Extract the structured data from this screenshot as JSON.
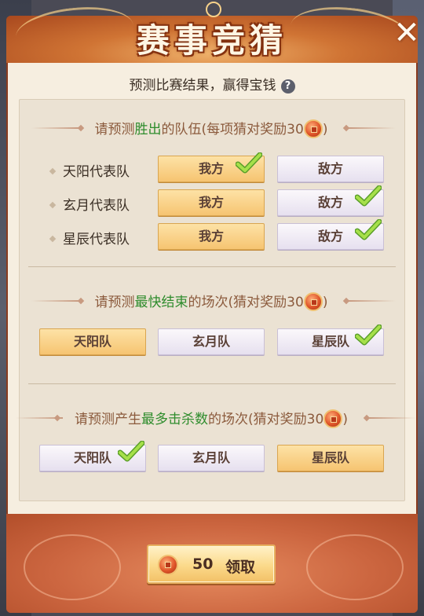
{
  "header": {
    "title": "赛事竞猜"
  },
  "subtitle": {
    "text": "预测比赛结果，赢得宝钱",
    "help_icon": "question-icon"
  },
  "section1": {
    "prefix": "请预测",
    "highlight": "胜出",
    "suffix": "的队伍(每项猜对奖励30",
    "close": ")",
    "rows": [
      {
        "team": "天阳代表队",
        "our": "我方",
        "enemy": "敌方",
        "selected": "our"
      },
      {
        "team": "玄月代表队",
        "our": "我方",
        "enemy": "敌方",
        "selected": "enemy"
      },
      {
        "team": "星辰代表队",
        "our": "我方",
        "enemy": "敌方",
        "selected": "enemy"
      }
    ]
  },
  "section2": {
    "prefix": "请预测",
    "highlight": "最快结束",
    "suffix": "的场次(猜对奖励30",
    "close": ")",
    "options": [
      "天阳队",
      "玄月队",
      "星辰队"
    ],
    "selected": 2
  },
  "section3": {
    "prefix": "请预测产生",
    "highlight": "最多击杀数",
    "suffix": "的场次(猜对奖励30",
    "close": ")",
    "options": [
      "天阳队",
      "玄月队",
      "星辰队"
    ],
    "selected": 0
  },
  "claim": {
    "amount": "50",
    "label": "领取"
  },
  "colors": {
    "highlight": "#2e8c2c",
    "gold": "#f6c471",
    "silver": "#e6e0ef",
    "check": "#8fd33a"
  }
}
